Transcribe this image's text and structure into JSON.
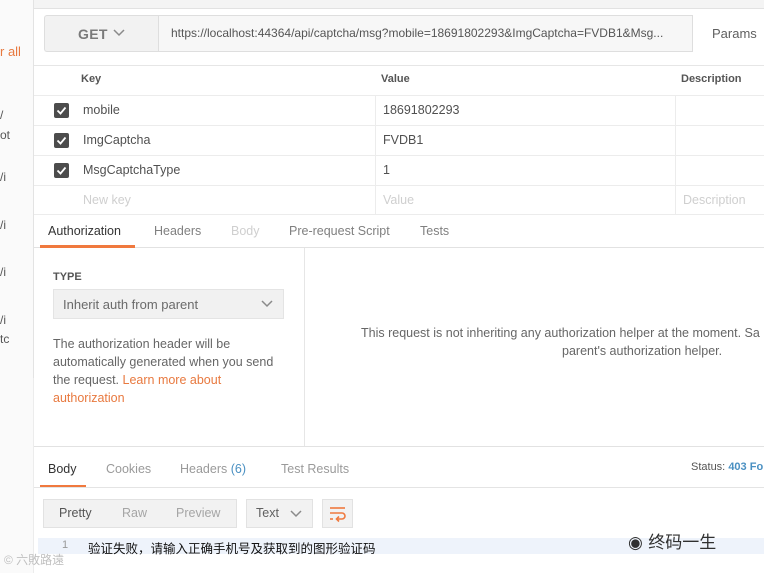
{
  "sidebar": {
    "clear_all": "r all",
    "fragments": [
      "/",
      "ot",
      "/i",
      "/i",
      "/i",
      "/i",
      "tc"
    ]
  },
  "request": {
    "method": "GET",
    "url": "https://localhost:44364/api/captcha/msg?mobile=18691802293&ImgCaptcha=FVDB1&Msg...",
    "params_label": "Params"
  },
  "params_table": {
    "headers": {
      "key": "Key",
      "value": "Value",
      "description": "Description"
    },
    "rows": [
      {
        "key": "mobile",
        "value": "18691802293",
        "checked": true
      },
      {
        "key": "ImgCaptcha",
        "value": "FVDB1",
        "checked": true
      },
      {
        "key": "MsgCaptchaType",
        "value": "1",
        "checked": true
      }
    ],
    "placeholders": {
      "key": "New key",
      "value": "Value",
      "description": "Description"
    }
  },
  "request_tabs": {
    "authorization": "Authorization",
    "headers": "Headers",
    "body": "Body",
    "pre_request": "Pre-request Script",
    "tests": "Tests"
  },
  "auth": {
    "type_label": "TYPE",
    "type_value": "Inherit auth from parent",
    "description": "The authorization header will be automatically generated when you send the request. ",
    "learn_more": "Learn more about authorization",
    "message_line1": "This request is not inheriting any authorization helper at the moment. Sa",
    "message_line2": "parent's authorization helper."
  },
  "response": {
    "tabs": {
      "body": "Body",
      "cookies": "Cookies",
      "headers": "Headers",
      "headers_count": "(6)",
      "test_results": "Test Results"
    },
    "status_label": "Status:",
    "status_value": "403 Fo",
    "formats": {
      "pretty": "Pretty",
      "raw": "Raw",
      "preview": "Preview"
    },
    "text_type": "Text",
    "line_number": "1",
    "body_text": "验证失败，请输入正确手机号及获取到的图形验证码"
  },
  "watermarks": {
    "left": "© 六敗路遠",
    "right": "◉ 终码一生"
  },
  "colors": {
    "accent": "#f0793e",
    "link": "#4a90c2",
    "checkbox": "#4c4c4c"
  }
}
